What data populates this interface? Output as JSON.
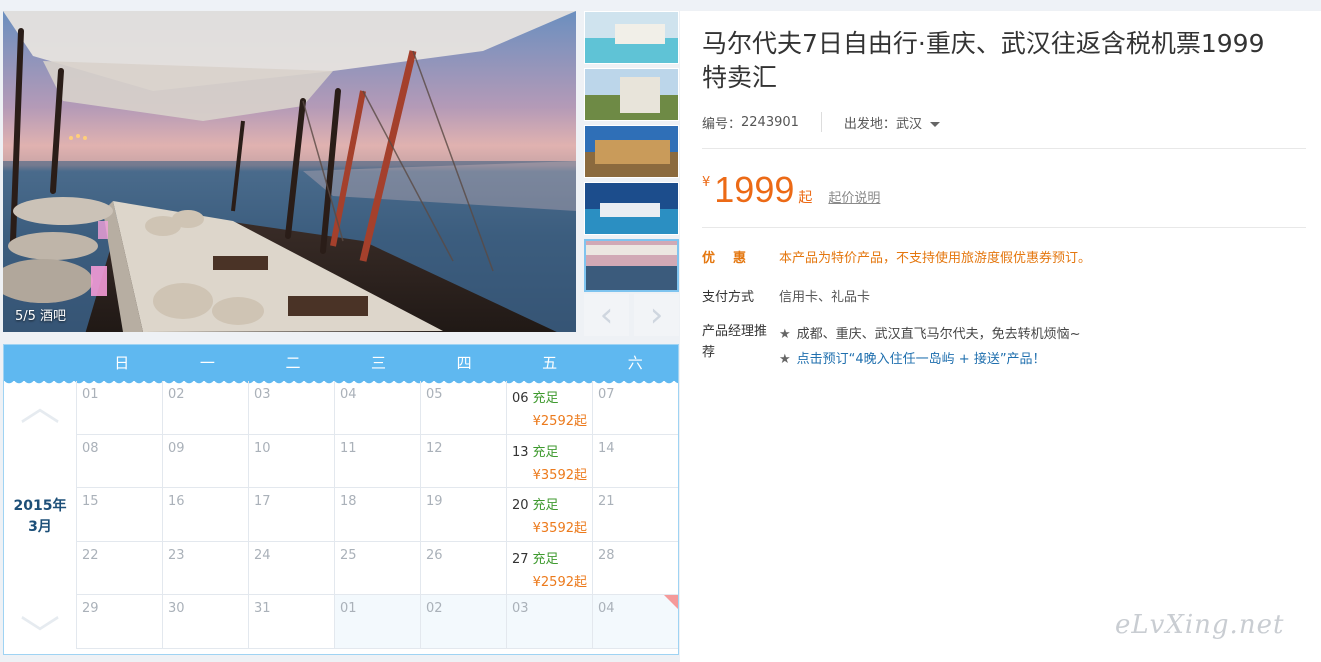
{
  "gallery": {
    "caption": "5/5 酒吧",
    "prev_icon": "‹",
    "next_icon": "›"
  },
  "calendar": {
    "year_month": [
      "2015年",
      "3月"
    ],
    "weekdays": [
      "日",
      "一",
      "二",
      "三",
      "四",
      "五",
      "六"
    ],
    "up_icon": "︿",
    "down_icon": "﹀",
    "rows": [
      [
        {
          "d": "01"
        },
        {
          "d": "02"
        },
        {
          "d": "03"
        },
        {
          "d": "04"
        },
        {
          "d": "05"
        },
        {
          "d": "06",
          "stock": "充足",
          "price": "¥2592起"
        },
        {
          "d": "07"
        }
      ],
      [
        {
          "d": "08"
        },
        {
          "d": "09"
        },
        {
          "d": "10"
        },
        {
          "d": "11"
        },
        {
          "d": "12"
        },
        {
          "d": "13",
          "stock": "充足",
          "price": "¥3592起"
        },
        {
          "d": "14"
        }
      ],
      [
        {
          "d": "15"
        },
        {
          "d": "16"
        },
        {
          "d": "17"
        },
        {
          "d": "18"
        },
        {
          "d": "19"
        },
        {
          "d": "20",
          "stock": "充足",
          "price": "¥3592起"
        },
        {
          "d": "21"
        }
      ],
      [
        {
          "d": "22"
        },
        {
          "d": "23"
        },
        {
          "d": "24"
        },
        {
          "d": "25"
        },
        {
          "d": "26"
        },
        {
          "d": "27",
          "stock": "充足",
          "price": "¥2592起"
        },
        {
          "d": "28"
        }
      ],
      [
        {
          "d": "29"
        },
        {
          "d": "30"
        },
        {
          "d": "31"
        },
        {
          "d": "01",
          "next": true
        },
        {
          "d": "02",
          "next": true
        },
        {
          "d": "03",
          "next": true
        },
        {
          "d": "04",
          "next": true,
          "corner": true
        }
      ]
    ]
  },
  "product": {
    "title": "马尔代夫7日自由行·重庆、武汉往返含税机票1999特卖汇",
    "code_label": "编号：",
    "code": "2243901",
    "departure_label": "出发地：",
    "departure": "武汉",
    "price_symbol": "¥",
    "price": "1999",
    "price_suffix": "起",
    "price_note_link": "起价说明",
    "discount_label": "优惠",
    "discount_text": "本产品为特价产品，不支持使用旅游度假优惠券预订。",
    "payment_label": "支付方式",
    "payment_text": "信用卡、礼品卡",
    "manager_label": "产品经理推荐",
    "recommend_1": "成都、重庆、武汉直飞马尔代夫，免去转机烦恼~",
    "recommend_2": "点击预订“4晚入住任一岛屿 + 接送”产品！",
    "star": "★"
  },
  "watermark": "eLvXing.net",
  "colors": {
    "accent_blue": "#5fb8f0",
    "price_orange": "#ec6a16",
    "stock_green": "#3f9a2f"
  }
}
